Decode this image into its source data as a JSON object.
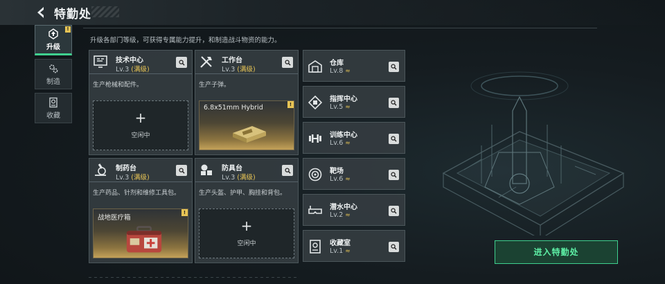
{
  "header": {
    "title": "特勤处"
  },
  "sidebar": {
    "items": [
      {
        "label": "升级",
        "icon": "upgrade-icon",
        "active": true,
        "badge": "!"
      },
      {
        "label": "制造",
        "icon": "gears-icon",
        "active": false
      },
      {
        "label": "收藏",
        "icon": "collection-icon",
        "active": false
      }
    ]
  },
  "main": {
    "subtitle": "升级各部门等级，可获得专属能力提升，和制造战斗物资的能力。",
    "workstations": [
      {
        "name": "技术中心",
        "level": "Lv.3",
        "max": "(满级)",
        "desc": "生产枪械和配件。",
        "slot": {
          "state": "idle",
          "plus": "+",
          "label": "空闲中"
        }
      },
      {
        "name": "工作台",
        "level": "Lv.3",
        "max": "(满级)",
        "desc": "生产子弹。",
        "slot": {
          "state": "item",
          "item": "6.8x51mm Hybrid",
          "badge": "!"
        }
      },
      {
        "name": "制药台",
        "level": "Lv.3",
        "max": "(满级)",
        "desc": "生产药品、针剂和维修工具包。",
        "slot": {
          "state": "item",
          "item": "战地医疗箱",
          "badge": "!"
        }
      },
      {
        "name": "防具台",
        "level": "Lv.3",
        "max": "(满级)",
        "desc": "生产头盔、护甲、胸挂和背包。",
        "slot": {
          "state": "idle",
          "plus": "+",
          "label": "空闲中"
        }
      }
    ],
    "facilities": [
      {
        "name": "仓库",
        "level": "Lv.8",
        "up": "≈",
        "icon": "warehouse-icon"
      },
      {
        "name": "指挥中心",
        "level": "Lv.5",
        "up": "≈",
        "icon": "command-icon"
      },
      {
        "name": "训练中心",
        "level": "Lv.6",
        "up": "≈",
        "icon": "dumbbell-icon"
      },
      {
        "name": "靶场",
        "level": "Lv.6",
        "up": "≈",
        "icon": "target-icon"
      },
      {
        "name": "潜水中心",
        "level": "Lv.2",
        "up": "≈",
        "icon": "diving-mask-icon"
      },
      {
        "name": "收藏室",
        "level": "Lv.1",
        "up": "≈",
        "icon": "collection-room-icon"
      }
    ]
  },
  "enter_button": {
    "label": "进入特勤处"
  },
  "colors": {
    "accent_green": "#3fd18f",
    "gold": "#e7c455",
    "panel": "#343c40"
  }
}
